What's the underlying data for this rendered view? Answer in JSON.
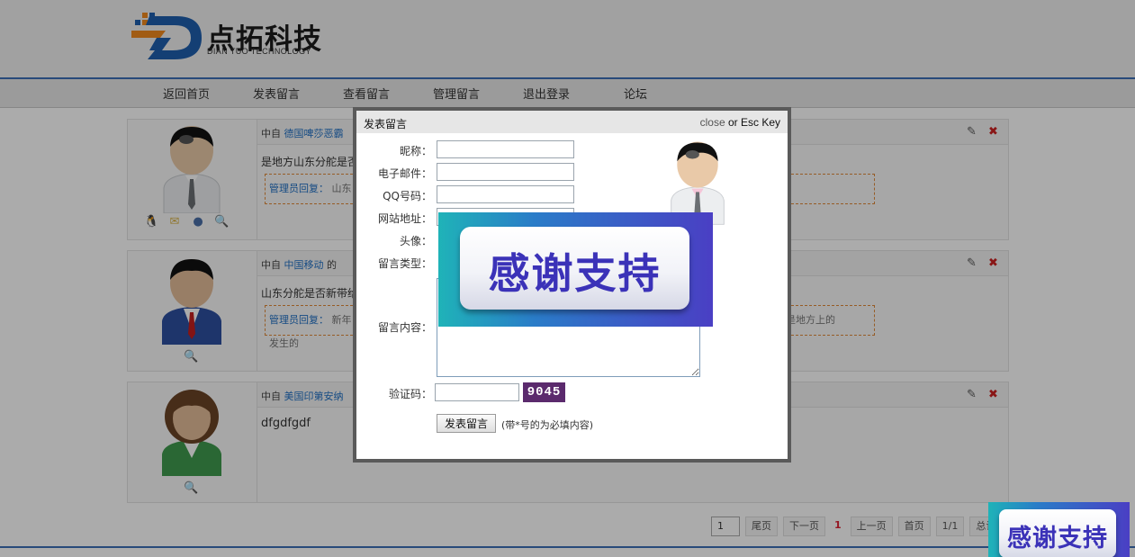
{
  "brand": {
    "name_cn": "点拓科技",
    "name_en": "DIAN TUO TECHNOLOGY",
    "colors": {
      "primary_blue": "#1f5fae",
      "accent_orange": "#f08a1e",
      "nav_rule": "#3c6fb6"
    }
  },
  "nav": {
    "items": [
      {
        "label": "返回首页"
      },
      {
        "label": "发表留言"
      },
      {
        "label": "查看留言"
      },
      {
        "label": "管理留言"
      },
      {
        "label": "退出登录"
      },
      {
        "label": "论坛"
      }
    ]
  },
  "messages": [
    {
      "head_prefix": "中自",
      "author": "德国啤莎恶霸",
      "body": "是地方山东分舵是否",
      "reply_label": "管理员回复：",
      "reply_text": "山东",
      "icons": [
        "qq-icon",
        "email-icon",
        "homepage-icon",
        "zoom-icon"
      ]
    },
    {
      "head_prefix": "中自",
      "author": "中国移动",
      "author_suffix": "的",
      "body": "山东分舵是否新带给",
      "reply_label": "管理员回复：",
      "reply_text": "新年",
      "reply_tail": "是否是地方上的",
      "reply_line2": "发生的",
      "icons": [
        "zoom-icon"
      ]
    },
    {
      "head_prefix": "中自",
      "author": "美国印第安纳",
      "body": "dfgdfgdf",
      "icons": [
        "zoom-icon"
      ]
    }
  ],
  "pager": {
    "current_input": "1",
    "last": "尾页",
    "next": "下一页",
    "current_page": "1",
    "prev": "上一页",
    "first": "首页",
    "of": "1/1",
    "total": "总记录"
  },
  "modal": {
    "title": "发表留言",
    "close_text": "close",
    "close_or": " or Esc Key",
    "fields": {
      "nickname_label": "昵称：",
      "email_label": "电子邮件：",
      "qq_label": "QQ号码：",
      "website_label": "网站地址：",
      "avatar_label": "头像：",
      "type_label": "留言类型：",
      "content_label": "留言内容：",
      "captcha_label": "验证码："
    },
    "captcha_value": "9045",
    "submit_label": "发表留言",
    "hint": "(带*号的为必填内容)"
  },
  "banner": {
    "text": "感谢支持",
    "text_small": "感谢支持"
  }
}
